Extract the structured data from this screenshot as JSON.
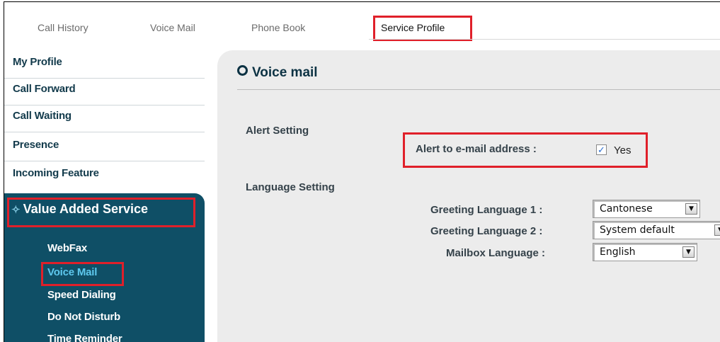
{
  "tabs": [
    {
      "label": "Call History"
    },
    {
      "label": "Voice Mail"
    },
    {
      "label": "Phone Book"
    },
    {
      "label": "Service Profile"
    }
  ],
  "sidebar": {
    "items": [
      {
        "label": "My Profile"
      },
      {
        "label": "Call Forward"
      },
      {
        "label": "Call Waiting"
      },
      {
        "label": "Presence"
      },
      {
        "label": "Incoming Feature"
      }
    ],
    "section": {
      "title": "Value Added Service",
      "chevron": "✧",
      "items": [
        {
          "label": "WebFax"
        },
        {
          "label": "Voice Mail"
        },
        {
          "label": "Speed Dialing"
        },
        {
          "label": "Do Not Disturb"
        },
        {
          "label": "Time Reminder"
        }
      ]
    }
  },
  "main": {
    "title": "Voice mail",
    "alert": {
      "section_label": "Alert Setting",
      "field_label": "Alert to e-mail address :",
      "checked": true,
      "check_glyph": "✓",
      "value_label": "Yes"
    },
    "language": {
      "section_label": "Language Setting",
      "rows": [
        {
          "label": "Greeting Language 1 :",
          "value": "Cantonese"
        },
        {
          "label": "Greeting Language 2 :",
          "value": "System default"
        },
        {
          "label": "Mailbox Language :",
          "value": "English"
        }
      ]
    }
  },
  "colors": {
    "highlight": "#e0202a",
    "sidebar_section_bg": "#0f4f66",
    "active_subitem": "#5ec8ee",
    "panel_bg": "#ececec"
  },
  "icons": {
    "panel_title": "ring-bullet-icon",
    "section_chevron": "double-chevron-icon",
    "select_arrow": "dropdown-arrow-icon",
    "checkbox": "checkmark-icon"
  }
}
